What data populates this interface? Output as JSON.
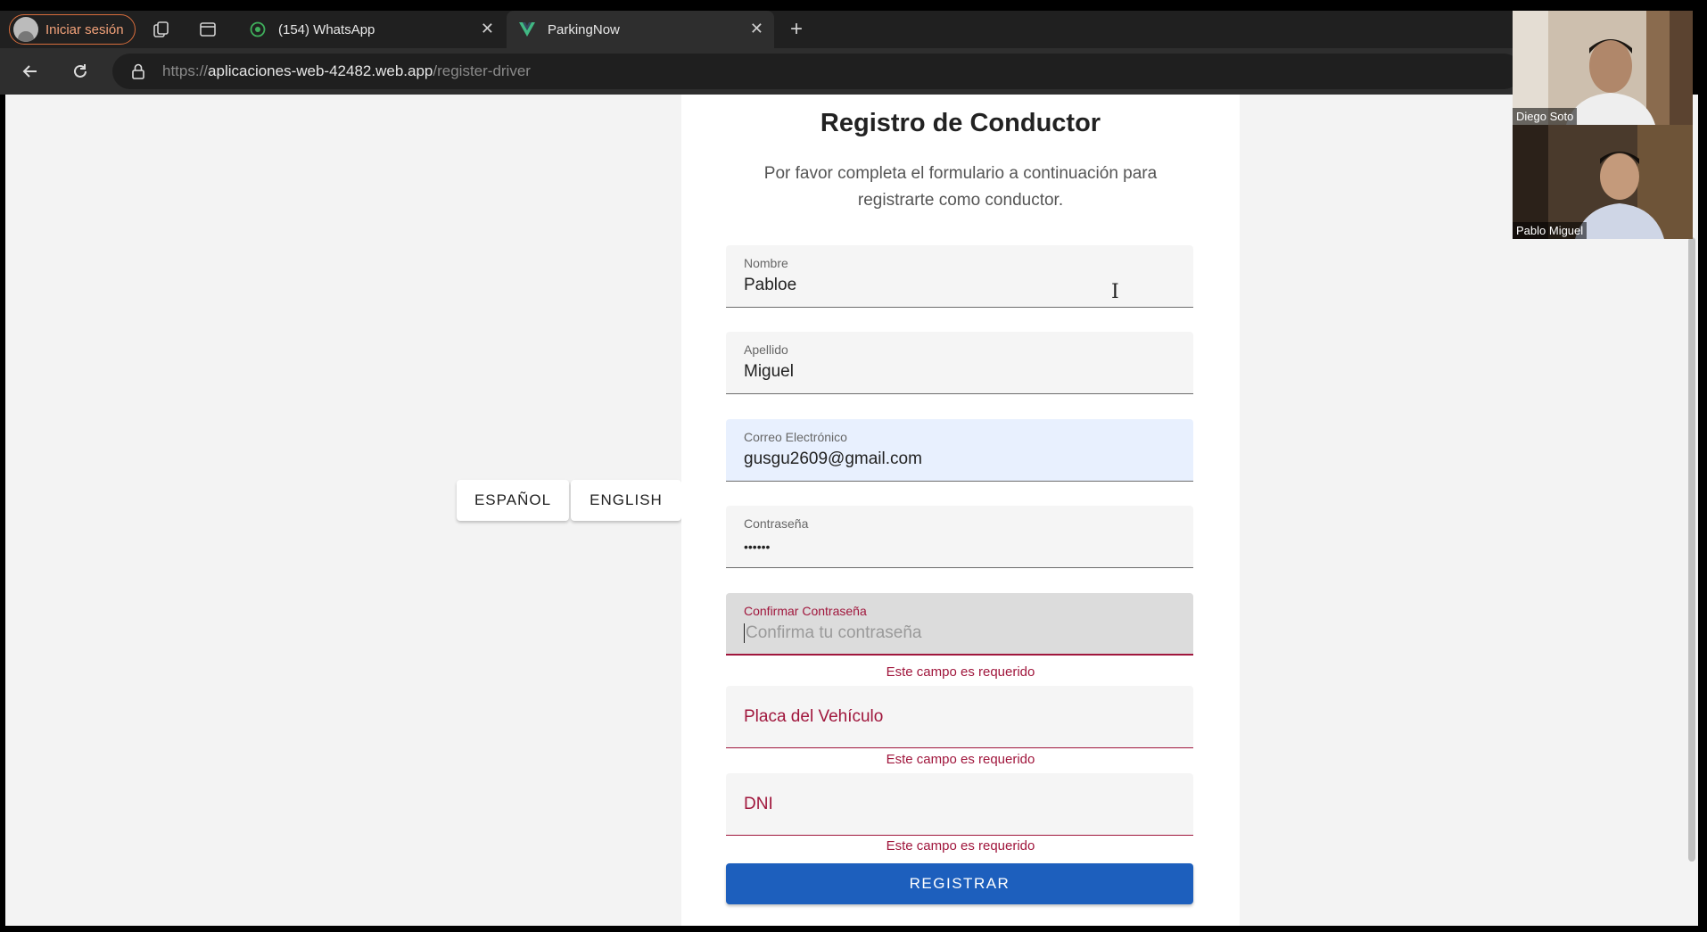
{
  "browser": {
    "profile_label": "Iniciar sesión",
    "tabs": [
      {
        "title": "(154) WhatsApp",
        "active": false,
        "favicon": "whatsapp-icon"
      },
      {
        "title": "ParkingNow",
        "active": true,
        "favicon": "vue-icon"
      }
    ],
    "url_scheme": "https://",
    "url_host": "aplicaciones-web-42482.web.app",
    "url_path": "/register-driver"
  },
  "language": {
    "spanish_label": "ESPAÑOL",
    "english_label": "ENGLISH"
  },
  "form": {
    "title": "Registro de Conductor",
    "subtitle": "Por favor completa el formulario a continuación para registrarte como conductor.",
    "nombre_label": "Nombre",
    "nombre_value": "Pabloe",
    "apellido_label": "Apellido",
    "apellido_value": "Miguel",
    "email_label": "Correo Electrónico",
    "email_value": "gusgu2609@gmail.com",
    "password_label": "Contraseña",
    "password_value": "••••••",
    "confirm_label": "Confirmar Contraseña",
    "confirm_placeholder": "Confirma tu contraseña",
    "placa_label": "Placa del Vehículo",
    "dni_label": "DNI",
    "required_error": "Este campo es requerido",
    "submit_label": "REGISTRAR"
  },
  "participants": [
    {
      "name": "Diego Soto"
    },
    {
      "name": "Pablo Miguel"
    }
  ],
  "colors": {
    "primary": "#1d5fbd",
    "error": "#a0163c",
    "autofill": "#e8f0fe"
  }
}
